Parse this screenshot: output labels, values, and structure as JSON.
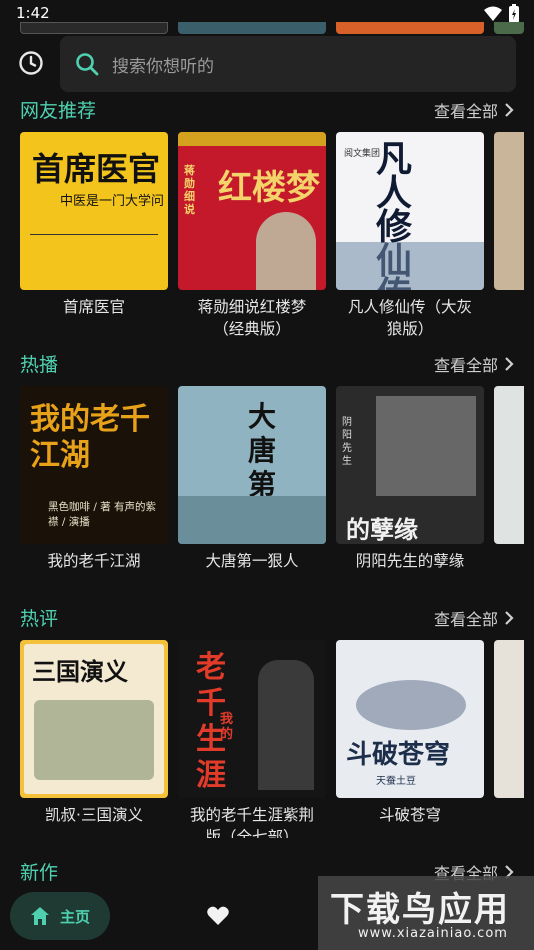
{
  "status": {
    "time": "1:42"
  },
  "search": {
    "placeholder": "搜索你想听的"
  },
  "see_all_label": "查看全部",
  "sections": [
    {
      "title": "网友推荐",
      "books": [
        {
          "title": "首席医官",
          "cover_text": "首席医官",
          "cover_sub": "中医是一门大学问"
        },
        {
          "title": "蒋勋细说红楼梦\n（经典版）",
          "cover_text": "红楼梦",
          "cover_sub": "蒋勋 细说"
        },
        {
          "title": "凡人修仙传（大灰\n狼版）",
          "cover_text": "凡人修仙传",
          "cover_sub": "阅文集团"
        }
      ]
    },
    {
      "title": "热播",
      "books": [
        {
          "title": "我的老千江湖",
          "cover_text": "我的老千江湖",
          "cover_sub": "黑色咖啡 / 著 有声的紫襟 / 演播"
        },
        {
          "title": "大唐第一狠人",
          "cover_text": "大唐第一狠人",
          "cover_sub": ""
        },
        {
          "title": "阴阳先生的孽缘",
          "cover_text": "的孽缘",
          "cover_sub": "阴阳先生"
        }
      ]
    },
    {
      "title": "热评",
      "books": [
        {
          "title": "凯叔·三国演义",
          "cover_text": "三国演义",
          "cover_sub": ""
        },
        {
          "title": "我的老千生涯紫荆\n版（全七部）",
          "cover_text": "老千生涯",
          "cover_sub": "我的"
        },
        {
          "title": "斗破苍穹",
          "cover_text": "斗破苍穹",
          "cover_sub": "天蚕土豆"
        }
      ]
    },
    {
      "title": "新作",
      "books": []
    }
  ],
  "nav": {
    "home_label": "主页"
  },
  "watermark": {
    "main": "下载鸟应用",
    "sub": "www.xiazainiao.com"
  },
  "colors": {
    "accent": "#4fd1b0",
    "background": "#121212"
  }
}
